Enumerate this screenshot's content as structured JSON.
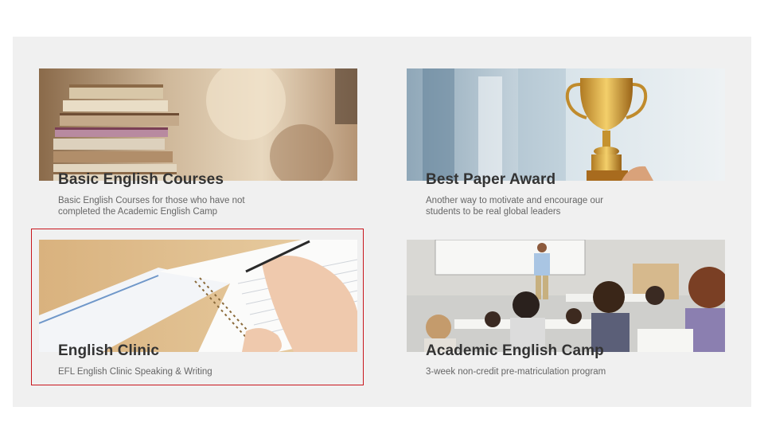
{
  "cards": [
    {
      "title": "Basic English Courses",
      "description": "Basic English Courses for those who have not completed the Academic English Camp",
      "image": "books-stack-icon"
    },
    {
      "title": "Best Paper Award",
      "description": "Another way to motivate and encourage our students to be real global leaders",
      "image": "trophy-icon"
    },
    {
      "title": "English Clinic",
      "description": "EFL English Clinic Speaking & Writing",
      "image": "notebook-writing-icon"
    },
    {
      "title": "Academic English Camp",
      "description": "3-week non-credit pre-matriculation program",
      "image": "lecture-classroom-icon"
    }
  ],
  "highlight_color": "#c8161d",
  "panel_color": "#f0f0f0"
}
